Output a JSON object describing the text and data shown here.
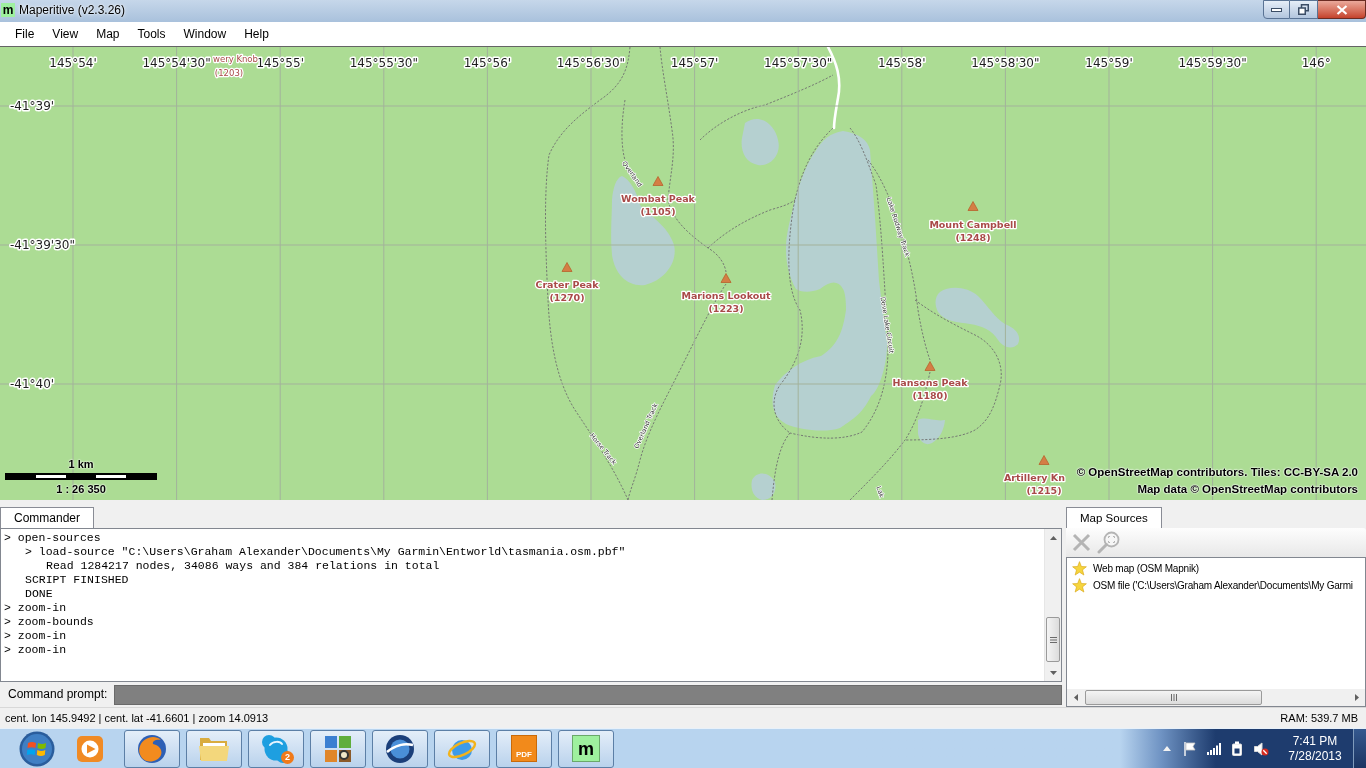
{
  "window": {
    "icon_text": "m",
    "title": "Maperitive (v2.3.26)"
  },
  "menu": [
    "File",
    "View",
    "Map",
    "Tools",
    "Window",
    "Help"
  ],
  "map": {
    "longitude_labels": [
      "145°54'",
      "145°54'30\"",
      "145°55'",
      "145°55'30\"",
      "145°56'",
      "145°56'30\"",
      "145°57'",
      "145°57'30\"",
      "145°58'",
      "145°58'30\"",
      "145°59'",
      "145°59'30\"",
      "146°"
    ],
    "latitude_labels": [
      "-41°39'",
      "-41°39'30\"",
      "-41°40'"
    ],
    "places": [
      {
        "name": "wery Knob",
        "elevation": "(1203)",
        "marker": false
      },
      {
        "name": "Wombat Peak",
        "elevation": "(1105)",
        "marker": true
      },
      {
        "name": "Crater Peak",
        "elevation": "(1270)",
        "marker": true
      },
      {
        "name": "Marions Lookout",
        "elevation": "(1223)",
        "marker": true
      },
      {
        "name": "Mount Campbell",
        "elevation": "(1248)",
        "marker": true
      },
      {
        "name": "Hansons Peak",
        "elevation": "(1180)",
        "marker": true
      },
      {
        "name": "Artillery Kn",
        "elevation": "(1215)",
        "marker": true
      }
    ],
    "track_labels": [
      "Overland",
      "Lake Rodway Track",
      "Dove Lake Circuit",
      "Horse Track",
      "Overland Track",
      "Lak"
    ],
    "scale_bar": {
      "distance": "1 km",
      "ratio": "1 : 26 350"
    },
    "attribution": [
      "© OpenStreetMap contributors. Tiles: CC-BY-SA 2.0",
      "Map data © OpenStreetMap contributors"
    ]
  },
  "commander": {
    "tab": {
      "label": "Commander",
      "selected": true
    },
    "lines": [
      {
        "text": "> open-sources",
        "children": [
          {
            "text": "> load-source \"C:\\Users\\Graham Alexander\\Documents\\My Garmin\\Entworld\\tasmania.osm.pbf\"",
            "children": [
              {
                "text": "Read 1284217 nodes, 34086 ways and 384 relations in total"
              }
            ]
          },
          {
            "text": "SCRIPT FINISHED"
          },
          {
            "text": "DONE"
          }
        ]
      },
      {
        "text": "> zoom-in"
      },
      {
        "text": "> zoom-bounds"
      },
      {
        "text": "> zoom-in"
      },
      {
        "text": "> zoom-in"
      }
    ],
    "prompt": {
      "label": "Command prompt:"
    }
  },
  "map_sources": {
    "tab": {
      "label": "Map Sources",
      "selected": true
    },
    "toolbar": [
      {
        "kind": "remove",
        "disabled": true
      },
      {
        "kind": "zoom",
        "disabled": true
      }
    ],
    "items": [
      {
        "label": "Web map (OSM Mapnik)",
        "selected": false
      },
      {
        "label": "OSM file ('C:\\Users\\Graham Alexander\\Documents\\My Garmi",
        "selected": false
      }
    ]
  },
  "status_bar": {
    "position": "cent. lon 145.9492 | cent. lat -41.6601 | zoom 14.0913",
    "memory": "RAM: 539.7 MB"
  },
  "taskbar": {
    "apps": [
      {
        "kind": "media",
        "running": false
      },
      {
        "kind": "globe",
        "running": true
      },
      {
        "kind": "folder",
        "running": true
      },
      {
        "kind": "chat",
        "running": true,
        "badge": "2"
      },
      {
        "kind": "tiles",
        "running": true
      },
      {
        "kind": "earth",
        "running": true
      },
      {
        "kind": "orbit",
        "running": true
      },
      {
        "kind": "pdf",
        "running": true,
        "icon_text": "PDF"
      },
      {
        "kind": "letter",
        "running": true,
        "icon_text": "m"
      }
    ],
    "clock": {
      "time": "7:41 PM",
      "date": "7/28/2013"
    }
  }
}
